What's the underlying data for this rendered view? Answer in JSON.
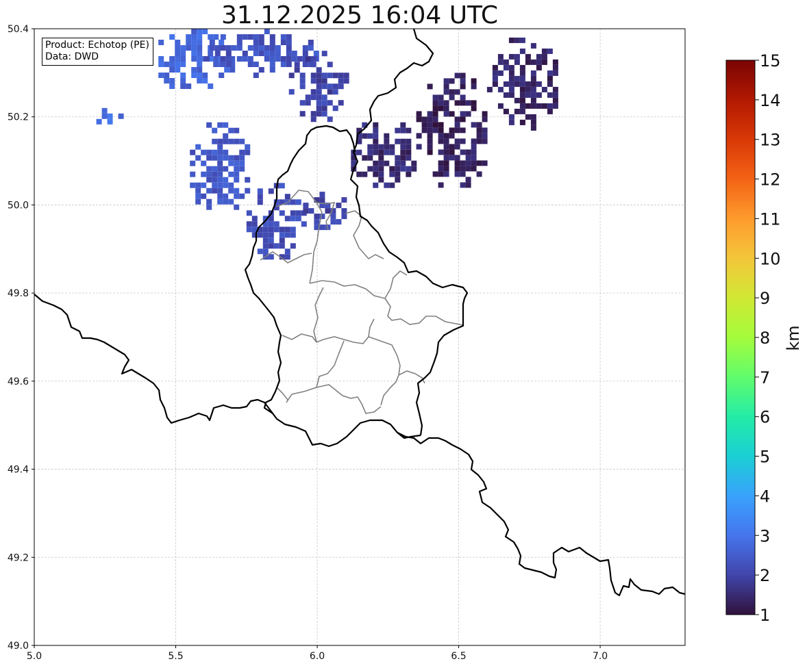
{
  "title": "31.12.2025 16:04 UTC",
  "info": {
    "product_line": "Product: Echotop (PE)",
    "data_line": "Data: DWD"
  },
  "map": {
    "lon_range": [
      5.0,
      7.3
    ],
    "lat_range": [
      49.0,
      50.4
    ],
    "x_ticks": [
      "5.0",
      "5.5",
      "6.0",
      "6.5",
      "7.0"
    ],
    "y_ticks": [
      "49.0",
      "49.2",
      "49.4",
      "49.6",
      "49.8",
      "50.0",
      "50.2",
      "50.4"
    ],
    "grid": true,
    "border_color": "#000000",
    "admin_border_color": "#808080"
  },
  "colorbar": {
    "label": "km",
    "ticks": [
      "1",
      "2",
      "3",
      "4",
      "5",
      "6",
      "7",
      "8",
      "9",
      "10",
      "11",
      "12",
      "13",
      "14",
      "15"
    ],
    "range": [
      1,
      15
    ],
    "colors": [
      "#30123b",
      "#4145ab",
      "#4675ed",
      "#39a2fc",
      "#1bcfd4",
      "#24eca6",
      "#61fc6c",
      "#a4fc3b",
      "#d1e834",
      "#f3c63a",
      "#fe9b2d",
      "#f36315",
      "#d93806",
      "#b11901",
      "#7a0403"
    ]
  },
  "echo_regions": [
    {
      "lon": [
        5.4,
        5.7
      ],
      "lat": [
        50.27,
        50.4
      ],
      "value": 2.7
    },
    {
      "lon": [
        5.6,
        6.0
      ],
      "lat": [
        50.3,
        50.4
      ],
      "value": 2.3
    },
    {
      "lon": [
        5.9,
        6.1
      ],
      "lat": [
        50.2,
        50.35
      ],
      "value": 2.0
    },
    {
      "lon": [
        6.1,
        6.35
      ],
      "lat": [
        50.05,
        50.2
      ],
      "value": 1.5
    },
    {
      "lon": [
        6.35,
        6.6
      ],
      "lat": [
        50.05,
        50.3
      ],
      "value": 1.3
    },
    {
      "lon": [
        6.6,
        6.85
      ],
      "lat": [
        50.18,
        50.38
      ],
      "value": 1.4
    },
    {
      "lon": [
        5.75,
        5.95
      ],
      "lat": [
        49.88,
        50.05
      ],
      "value": 2.2
    },
    {
      "lon": [
        5.95,
        6.1
      ],
      "lat": [
        49.95,
        50.03
      ],
      "value": 2.0
    },
    {
      "lon": [
        5.55,
        5.75
      ],
      "lat": [
        49.98,
        50.2
      ],
      "value": 2.4
    },
    {
      "lon": [
        5.2,
        5.3
      ],
      "lat": [
        50.19,
        50.22
      ],
      "value": 2.8
    }
  ]
}
